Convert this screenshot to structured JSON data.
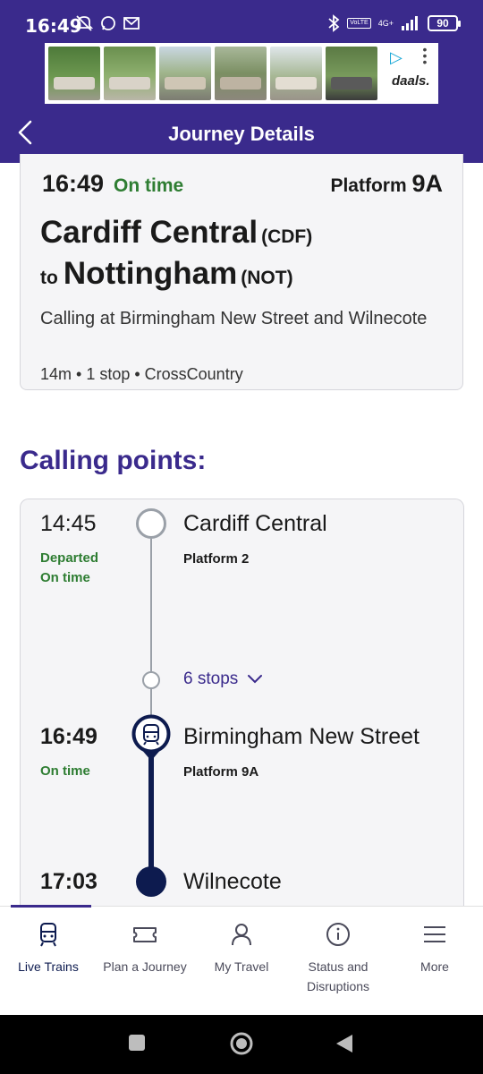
{
  "status_bar": {
    "time": "16:49",
    "network": "4G+",
    "volte": "VoLTE",
    "battery": "90",
    "icons": [
      "mute-icon",
      "whatsapp-icon",
      "outlook-icon",
      "bluetooth-icon",
      "signal-icon"
    ]
  },
  "ad": {
    "brand": "daals.",
    "colors": {
      "accent": "#15a6d6"
    }
  },
  "header": {
    "title": "Journey Details",
    "back_icon": "chevron-left-icon"
  },
  "summary": {
    "time": "16:49",
    "status": "On time",
    "platform_label": "Platform",
    "platform_number": "9A",
    "origin": "Cardiff Central",
    "origin_code": "(CDF)",
    "to_label": "to",
    "destination": "Nottingham",
    "destination_code": "(NOT)",
    "calling_at": "Calling at Birmingham New Street and Wilnecote",
    "meta": "14m • 1 stop • CrossCountry"
  },
  "calling_points": {
    "heading": "Calling points:",
    "stops_toggle": "6 stops",
    "stops": [
      {
        "time": "14:45",
        "status_line1": "Departed",
        "status_line2": "On time",
        "name": "Cardiff Central",
        "platform": "Platform 2"
      },
      {
        "time": "16:49",
        "status_line1": "On time",
        "name": "Birmingham New Street",
        "platform": "Platform 9A"
      },
      {
        "time": "17:03",
        "name": "Wilnecote"
      }
    ]
  },
  "bottom_nav": {
    "items": [
      {
        "label": "Live Trains",
        "icon": "train-icon",
        "active": true
      },
      {
        "label": "Plan a Journey",
        "icon": "ticket-icon"
      },
      {
        "label": "My Travel",
        "icon": "person-icon"
      },
      {
        "label": "Status and Disruptions",
        "icon": "info-icon"
      },
      {
        "label": "More",
        "icon": "menu-icon"
      }
    ]
  },
  "colors": {
    "brand": "#3a2a8c",
    "navy": "#0d1b4f",
    "on_time": "#2e7d32",
    "card_bg": "#f5f5f7"
  }
}
